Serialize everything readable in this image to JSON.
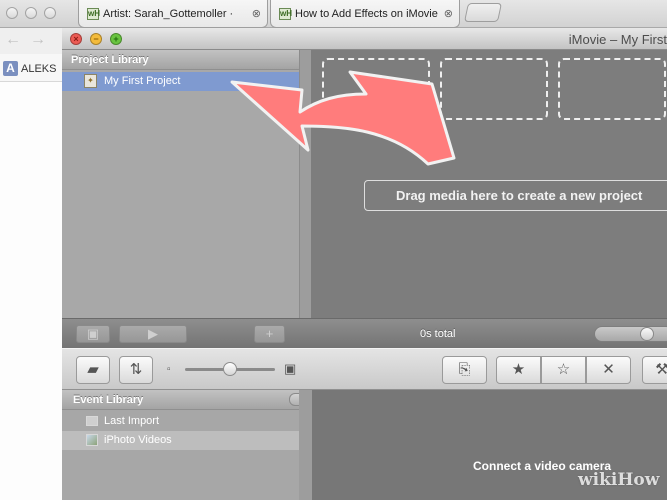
{
  "browser": {
    "tabs": [
      {
        "label": "Artist: Sarah_Gottemoller ·",
        "favicon": "wH",
        "close": "⊗"
      },
      {
        "label": "How to Add Effects on iMovie",
        "favicon": "wH",
        "close": "⊗"
      }
    ],
    "bookmark_logo": "A",
    "bookmark_label": "ALEKS"
  },
  "window": {
    "title": "iMovie – My First",
    "close_glyph": "×",
    "minimize_glyph": "−",
    "zoom_glyph": "+"
  },
  "project_library": {
    "heading": "Project Library",
    "items": [
      {
        "label": "My First Project",
        "selected": true
      }
    ],
    "drop_hint": "Drag media here to create a new project"
  },
  "project_bar": {
    "total_label": "0s total",
    "add_glyph": "+",
    "play_glyph": "▶"
  },
  "event_library": {
    "heading": "Event Library",
    "items": [
      {
        "label": "Last Import"
      },
      {
        "label": "iPhoto Videos",
        "selected": true
      }
    ]
  },
  "event_area": {
    "connect_hint": "Connect a video camera"
  },
  "toolbar": {
    "favorite_glyph": "★",
    "unmark_glyph": "☆",
    "reject_glyph": "✕"
  },
  "watermark": {
    "text": "wikiHow"
  },
  "colors": {
    "selection": "#7f9ad0",
    "arrow": "#ff7c7c",
    "panel_dark": "#7d7d7d"
  }
}
